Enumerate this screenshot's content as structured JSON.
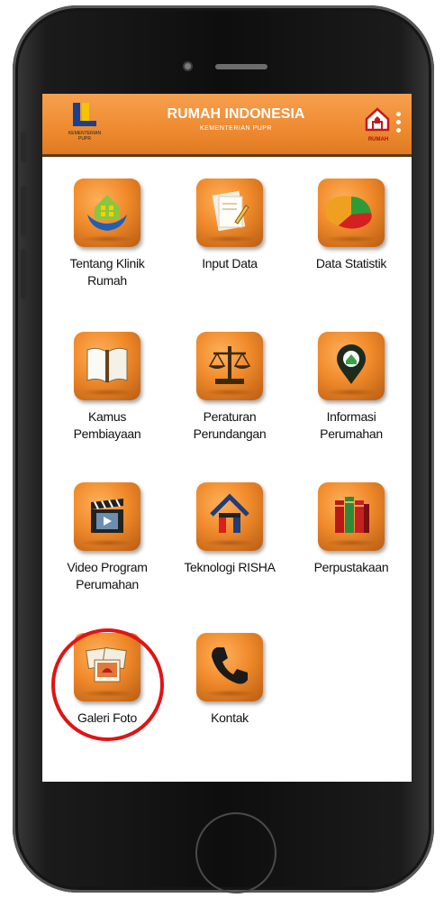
{
  "header": {
    "left_logo_caption": "KEMENTERIAN PUPR",
    "title": "RUMAH INDONESIA",
    "subtitle": "KEMENTERIAN PUPR",
    "right_logo_caption": "RUMAH",
    "color": "#ee8a30"
  },
  "menu": {
    "items": [
      {
        "label": "Tentang Klinik Rumah",
        "icon": "house-hands-icon"
      },
      {
        "label": "Input Data",
        "icon": "document-pencil-icon"
      },
      {
        "label": "Data Statistik",
        "icon": "pie-chart-icon"
      },
      {
        "label": "Kamus Pembiayaan",
        "icon": "book-icon"
      },
      {
        "label": "Peraturan Perundangan",
        "icon": "scales-icon"
      },
      {
        "label": "Informasi Perumahan",
        "icon": "map-pin-house-icon"
      },
      {
        "label": "Video Program Perumahan",
        "icon": "clapperboard-icon"
      },
      {
        "label": "Teknologi RISHA",
        "icon": "risha-house-icon"
      },
      {
        "label": "Perpustakaan",
        "icon": "books-icon"
      },
      {
        "label": "Galeri Foto",
        "icon": "photos-icon"
      },
      {
        "label": "Kontak",
        "icon": "phone-icon"
      }
    ]
  },
  "highlight_color": "#e01414"
}
